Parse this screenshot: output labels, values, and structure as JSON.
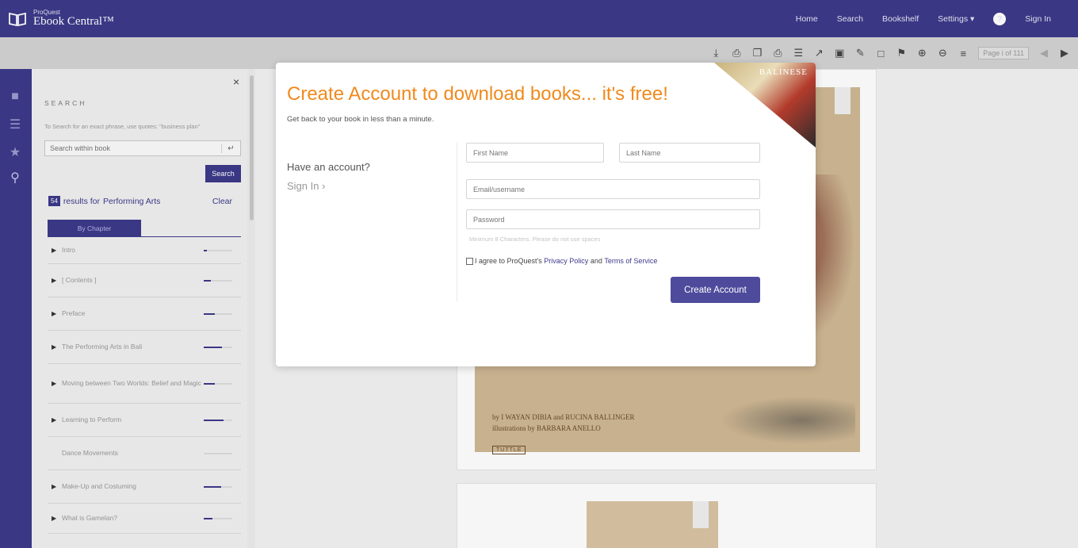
{
  "brand": {
    "small": "ProQuest",
    "name": "Ebook Central™"
  },
  "topnav": {
    "home": "Home",
    "search": "Search",
    "bookshelf": "Bookshelf",
    "settings": "Settings ▾",
    "help": "?",
    "signin": "Sign In"
  },
  "toolbar": {
    "page_indicator": "Page i of 111"
  },
  "search_panel": {
    "close": "×",
    "heading": "SEARCH",
    "hint": "To Search for an exact phrase, use quotes: \"business plan\"",
    "placeholder": "Search within book",
    "enter_glyph": "↵",
    "search_button": "Search",
    "result_count": "54",
    "results_text": "results for",
    "results_term": "Performing Arts",
    "clear": "Clear",
    "tab": "By Chapter",
    "chapters": [
      {
        "title": "Intro",
        "has_arrow": true,
        "relevance": 0.1
      },
      {
        "title": "[ Contents ]",
        "has_arrow": true,
        "relevance": 0.25
      },
      {
        "title": "Preface",
        "has_arrow": true,
        "relevance": 0.4
      },
      {
        "title": "The Performing Arts in Bali",
        "has_arrow": true,
        "relevance": 0.65
      },
      {
        "title": "Moving between Two Worlds: Belief and Magic",
        "has_arrow": true,
        "relevance": 0.4
      },
      {
        "title": "Learning to Perform",
        "has_arrow": true,
        "relevance": 0.7
      },
      {
        "title": "Dance Movements",
        "has_arrow": false,
        "relevance": 0
      },
      {
        "title": "Make-Up and Costuming",
        "has_arrow": true,
        "relevance": 0.6
      },
      {
        "title": "What is Gamelan?",
        "has_arrow": true,
        "relevance": 0.3
      }
    ]
  },
  "book": {
    "caption_line1": "by I WAYAN DIBIA and RUCINA BALLINGER",
    "caption_line2": "illustrations by BARBARA ANELLO",
    "publisher": "TUTTLE",
    "corner_title": "BALINESE"
  },
  "modal": {
    "title": "Create Account to download books... it's free!",
    "subtitle": "Get back to your book in less than a minute.",
    "have_account": "Have an account?",
    "sign_in": "Sign In ›",
    "first_name_placeholder": "First Name",
    "last_name_placeholder": "Last Name",
    "email_placeholder": "Email/username",
    "password_placeholder": "Password",
    "password_help": "Minimum 8 Characters. Please do not use spaces",
    "agree_prefix": "I agree to ProQuest's",
    "privacy_link": "Privacy Policy",
    "agree_and": "and",
    "terms_link": "Terms of Service",
    "create_button": "Create Account"
  }
}
